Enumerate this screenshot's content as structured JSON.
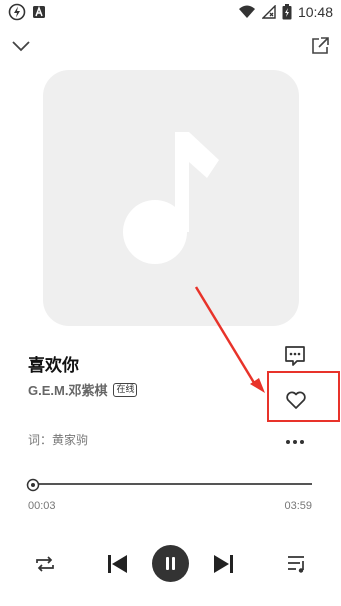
{
  "status_bar": {
    "time": "10:48",
    "icons": [
      "flash-icon",
      "a-notification-icon",
      "wifi-icon",
      "no-signal-icon",
      "battery-charging-icon"
    ]
  },
  "header": {
    "collapse_icon": "chevron-down-icon",
    "share_icon": "share-icon"
  },
  "cover": {
    "placeholder_icon": "music-note-icon"
  },
  "song": {
    "title": "喜欢你",
    "artist": "G.E.M.邓紫棋",
    "badge": "在线",
    "lyricist": "词：黄家驹"
  },
  "actions": {
    "comment_icon": "comment-icon",
    "favorite_icon": "heart-icon",
    "more_icon": "more-icon"
  },
  "annotation": {
    "highlight_color": "#e8332a"
  },
  "player": {
    "current_time": "00:03",
    "total_time": "03:59",
    "progress": 0.013
  },
  "controls": {
    "repeat_icon": "repeat-icon",
    "prev_icon": "previous-icon",
    "play_icon": "pause-icon",
    "next_icon": "next-icon",
    "playlist_icon": "playlist-icon"
  }
}
